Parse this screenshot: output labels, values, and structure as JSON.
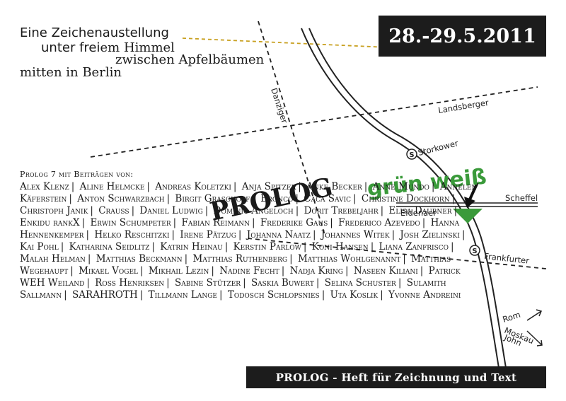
{
  "header": {
    "line1": "Eine Zeichenaustellung",
    "line2a": "unter frei",
    "line2b": "em Himmel",
    "line3": "zwischen Apfelbäumen",
    "line4": "mitten in Berlin"
  },
  "date": "28.-29.5.2011",
  "logo": {
    "prolog": "PROLOG",
    "gruen_weiss": "grün weiß",
    "green": "#3a9a3a"
  },
  "streets": {
    "danziger": "Danziger",
    "landsberger": "Landsberger",
    "storkower": "Storkower",
    "scheffel": "Scheffel",
    "eldenaer": "Eldenaer",
    "frankfurter": "Frankfurter",
    "rom": "Rom",
    "moskau": "Moskau",
    "john": "John",
    "s_bahn": "S"
  },
  "contributors": {
    "heading": "Prolog 7 mit Beiträgen von:",
    "names": [
      "Alex Klenz",
      "Aline Helmcke",
      "Andreas Koletzki",
      "Anja Spitzer",
      "Anke Becker",
      "Anne Mundo",
      "Annelen Käferstein",
      "Anton Schwarzbach",
      "Birgit Graschopf",
      "Bronco",
      "Caca Savic",
      "Christine Dockhorn",
      "Christoph Janik",
      "Crauss",
      "Daniel Ludwig",
      "Dominic Angeloch",
      "Dorit Trebeljahr",
      "Elisa Daubner",
      "Enkidu rankX",
      "Erwin Schumpeter",
      "Fabian Reimann",
      "Frederike Gaus",
      "Frederico Azevedo",
      "Hanna Hennenkemper",
      "Helko Reschitzki",
      "Irene Pätzug",
      "Johanna Naatz",
      "Johannes Witek",
      "Josh Zielinski",
      "Kai Pohl",
      "Katharina Seidlitz",
      "Katrin Heinau",
      "Kerstin Parlow",
      "Koni Hansen",
      "Liana Zanfrisco",
      "Malah Helman",
      "Matthias Beckmann",
      "Matthias Ruthenberg",
      "Matthias Wohlgenannt",
      "Matthias Wegehaupt",
      "Mikael Vogel",
      "Mikhail Lezin",
      "Nadine Fecht",
      "Nadja Kring",
      "Naseen Kiliani",
      "Patrick WEH Weiland",
      "Ross Henriksen",
      "Sabine Stützer",
      "Saskia Buwert",
      "Selina Schuster",
      "Sulamith Sallmann",
      "SARAHROTH",
      "Tillmann Lange",
      "Todosch Schlopsnies",
      "Uta Koslik",
      "Yvonne Andreini"
    ]
  },
  "footer": "PROLOG - Heft für Zeichnung und Text"
}
